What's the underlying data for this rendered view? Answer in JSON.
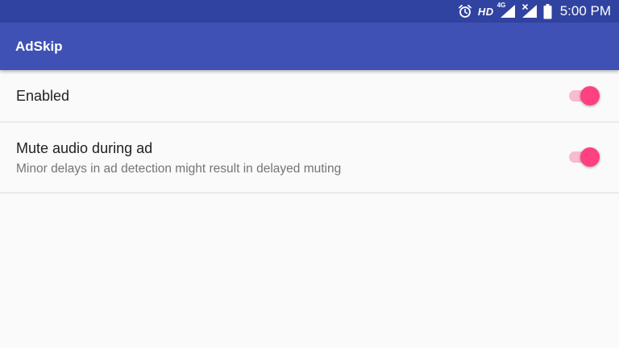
{
  "status_bar": {
    "alarm_icon": "alarm-clock-icon",
    "hd_label": "HD",
    "network_label": "4G",
    "signal_icon": "cell-signal-icon",
    "signal2_icon": "cell-signal-no-service-icon",
    "battery_icon": "battery-full-icon",
    "time": "5:00 PM",
    "background_color": "#3143a0"
  },
  "app_bar": {
    "title": "AdSkip",
    "background_color": "#3f51b5"
  },
  "settings": [
    {
      "title": "Enabled",
      "summary": "",
      "checked": true
    },
    {
      "title": "Mute audio during ad",
      "summary": "Minor delays in ad detection might result in delayed muting",
      "checked": true
    }
  ],
  "colors": {
    "accent": "#ff4081",
    "accent_track": "#f8bbd0",
    "background": "#fafafa"
  }
}
